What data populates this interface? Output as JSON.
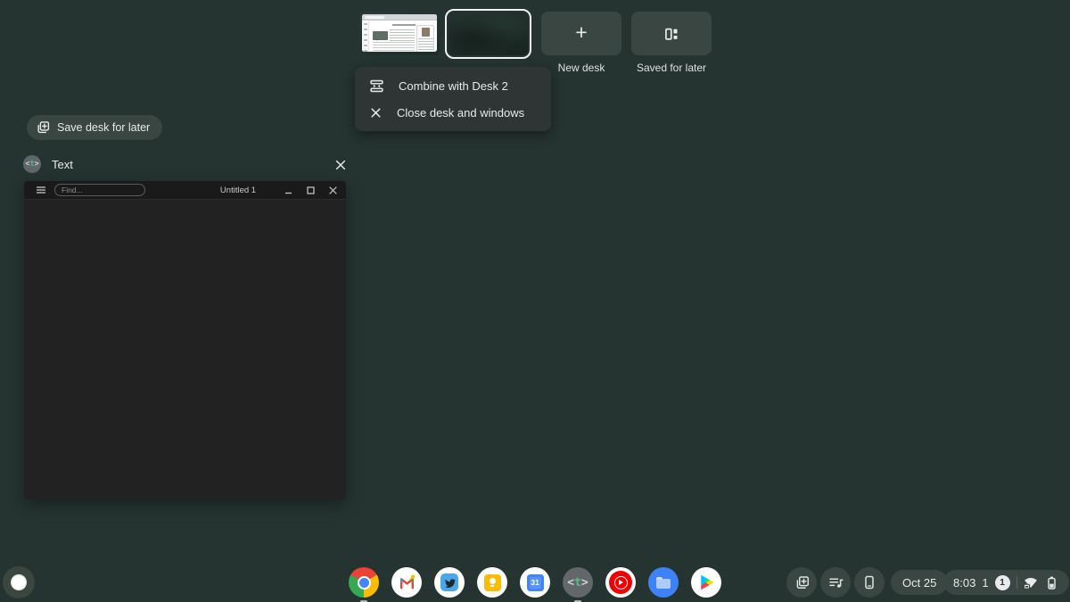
{
  "desk_bar": {
    "new_desk": "New desk",
    "saved_for_later": "Saved for later"
  },
  "desk_menu": {
    "combine": "Combine with Desk 2",
    "close": "Close desk and windows"
  },
  "save_desk_pill": {
    "label": "Save desk for later"
  },
  "overview_window": {
    "app_name": "Text",
    "glyph_open": "<",
    "glyph_t": "t",
    "glyph_close": ">"
  },
  "text_window": {
    "doc_title": "Untitled 1",
    "find_placeholder": "Find..."
  },
  "shelf": {
    "calendar_day": "31",
    "glyph_open": "<",
    "glyph_t": "t",
    "glyph_close": ">"
  },
  "status": {
    "date": "Oct 25",
    "time": "8:03",
    "indicator_digit": "1",
    "notification_count": "1"
  },
  "colors": {
    "background": "#253431",
    "pill_bg": "#3a4641",
    "menu_bg": "#2f3534",
    "accent_green": "#5bb974",
    "window_body": "#222222"
  }
}
